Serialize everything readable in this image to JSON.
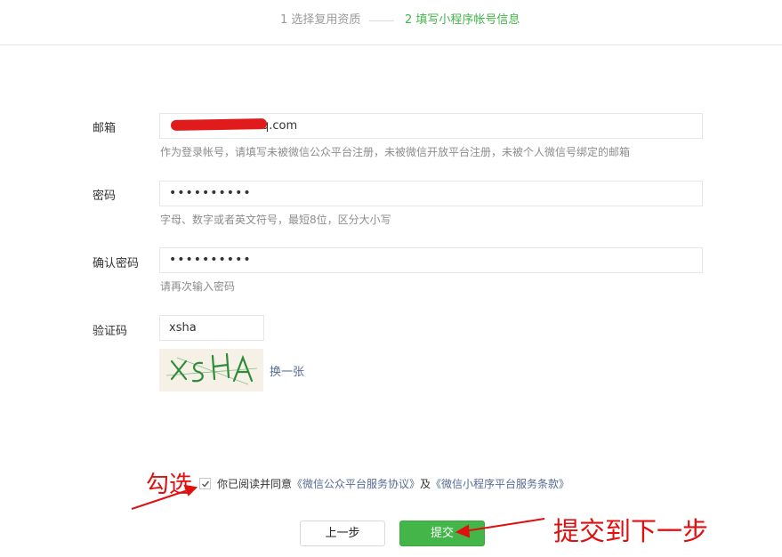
{
  "steps": {
    "step1": "1 选择复用资质",
    "step2": "2 填写小程序帐号信息"
  },
  "form": {
    "email": {
      "label": "邮箱",
      "value_suffix": "q.com",
      "hint": "作为登录帐号，请填写未被微信公众平台注册，未被微信开放平台注册，未被个人微信号绑定的邮箱"
    },
    "password": {
      "label": "密码",
      "value": "••••••••••",
      "hint": "字母、数字或者英文符号，最短8位，区分大小写"
    },
    "confirm_password": {
      "label": "确认密码",
      "value": "••••••••••",
      "hint": "请再次输入密码"
    },
    "captcha": {
      "label": "验证码",
      "value": "xsha",
      "image_text": "XSHA",
      "refresh_label": "换一张"
    }
  },
  "agreement": {
    "checked": true,
    "prefix": "你已阅读并同意",
    "link1": "《微信公众平台服务协议》",
    "and": "及",
    "link2": "《微信小程序平台服务条款》"
  },
  "buttons": {
    "prev_label": "上一步",
    "submit_label": "提交"
  },
  "annotations": {
    "check_note": "勾选",
    "submit_note": "提交到下一步",
    "color": "#e01010"
  },
  "colors": {
    "accent_green": "#44b549",
    "link_blue": "#576b95",
    "redaction_red": "#e11b1b"
  }
}
